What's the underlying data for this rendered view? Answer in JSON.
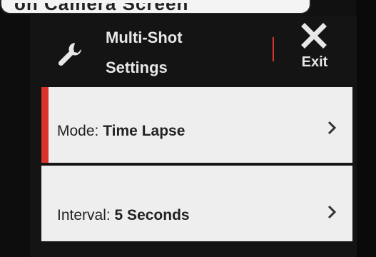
{
  "top_card": {
    "text": "on Camera Screen"
  },
  "header": {
    "icon": "wrench-icon",
    "title": "Multi-Shot\nSettings",
    "accent_color": "#d8342a"
  },
  "exit": {
    "icon": "close-icon",
    "label": "Exit"
  },
  "menu": {
    "items": [
      {
        "label": "Mode:",
        "value": "Time Lapse",
        "icon": "chevron-right-icon",
        "selected": true
      },
      {
        "label": "Interval:",
        "value": "5 Seconds",
        "icon": "chevron-right-icon",
        "selected": false
      }
    ]
  }
}
